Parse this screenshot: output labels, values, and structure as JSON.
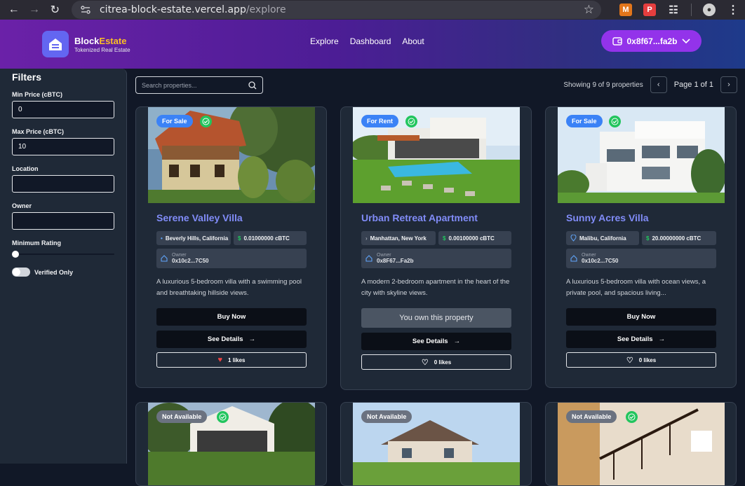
{
  "browser": {
    "url_host": "citrea-block-estate.vercel.app",
    "url_path": "/explore"
  },
  "header": {
    "brand_first": "Block",
    "brand_second": "Estate",
    "tagline": "Tokenized Real Estate",
    "nav": [
      "Explore",
      "Dashboard",
      "About"
    ],
    "wallet": "0x8f67...fa2b"
  },
  "filters": {
    "title": "Filters",
    "min_price_label": "Min Price (cBTC)",
    "min_price_value": "0",
    "max_price_label": "Max Price (cBTC)",
    "max_price_value": "10",
    "location_label": "Location",
    "owner_label": "Owner",
    "rating_label": "Minimum Rating",
    "rating_value": 0,
    "verified_label": "Verified Only"
  },
  "toolbar": {
    "search_placeholder": "Search properties...",
    "showing": "Showing 9 of 9 properties",
    "page_label": "Page 1 of 1"
  },
  "cards": [
    {
      "status": "For Sale",
      "title": "Serene Valley Villa",
      "location": "Beverly Hills, California",
      "price": "0.01000000 cBTC",
      "owner_label": "Owner",
      "owner": "0x10c2...7C50",
      "description": "A luxurious 5-bedroom villa with a swimming pool and breathtaking hillside views.",
      "primary_action": "Buy Now",
      "details_action": "See Details",
      "likes": "1 likes"
    },
    {
      "status": "For Rent",
      "title": "Urban Retreat Apartment",
      "location": "Manhattan, New York",
      "price": "0.00100000 cBTC",
      "owner_label": "Owner",
      "owner": "0x8F67...Fa2b",
      "description": "A modern 2-bedroom apartment in the heart of the city with skyline views.",
      "primary_action": "You own this property",
      "details_action": "See Details",
      "likes": "0 likes"
    },
    {
      "status": "For Sale",
      "title": "Sunny Acres Villa",
      "location": "Malibu, California",
      "price": "20.00000000 cBTC",
      "owner_label": "Owner",
      "owner": "0x10c2...7C50",
      "description": "A luxurious 5-bedroom villa with ocean views, a private pool, and spacious living...",
      "primary_action": "Buy Now",
      "details_action": "See Details",
      "likes": "0 likes"
    },
    {
      "status": "Not Available"
    },
    {
      "status": "Not Available"
    },
    {
      "status": "Not Available"
    }
  ]
}
